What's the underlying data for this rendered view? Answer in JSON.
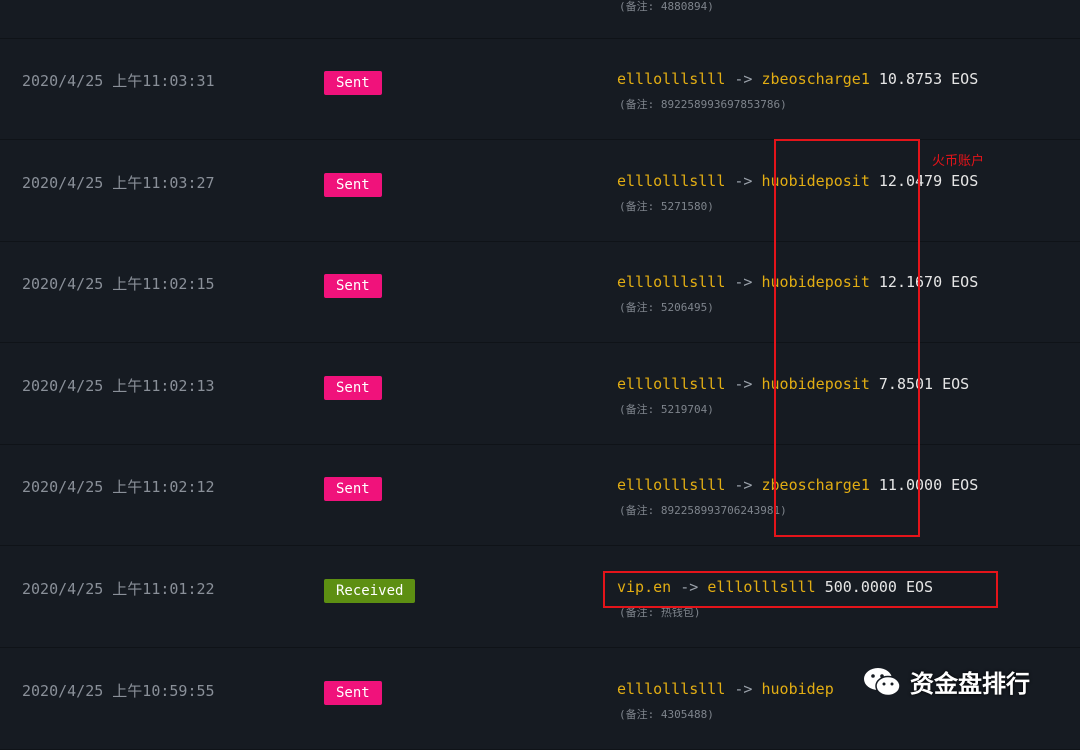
{
  "top_memo": "(备注: 4880894)",
  "rows": [
    {
      "timestamp": "2020/4/25 上午11:03:31",
      "status": "Sent",
      "from": "elllolllslll",
      "arrow": "->",
      "to": "zbeoscharge1",
      "amount": "10.8753 EOS",
      "memo": "(备注: 892258993697853786)"
    },
    {
      "timestamp": "2020/4/25 上午11:03:27",
      "status": "Sent",
      "from": "elllolllslll",
      "arrow": "->",
      "to": "huobideposit",
      "amount": "12.0479 EOS",
      "memo": "(备注: 5271580)"
    },
    {
      "timestamp": "2020/4/25 上午11:02:15",
      "status": "Sent",
      "from": "elllolllslll",
      "arrow": "->",
      "to": "huobideposit",
      "amount": "12.1670 EOS",
      "memo": "(备注: 5206495)"
    },
    {
      "timestamp": "2020/4/25 上午11:02:13",
      "status": "Sent",
      "from": "elllolllslll",
      "arrow": "->",
      "to": "huobideposit",
      "amount": "7.8501 EOS",
      "memo": "(备注: 5219704)"
    },
    {
      "timestamp": "2020/4/25 上午11:02:12",
      "status": "Sent",
      "from": "elllolllslll",
      "arrow": "->",
      "to": "zbeoscharge1",
      "amount": "11.0000 EOS",
      "memo": "(备注: 892258993706243981)"
    },
    {
      "timestamp": "2020/4/25 上午11:01:22",
      "status": "Received",
      "from": "vip.en",
      "arrow": "->",
      "to": "elllolllslll",
      "amount": "500.0000 EOS",
      "memo": "(备注: 热钱包)"
    },
    {
      "timestamp": "2020/4/25 上午10:59:55",
      "status": "Sent",
      "from": "elllolllslll",
      "arrow": "->",
      "to": "huobidep",
      "amount": "",
      "memo": "(备注: 4305488)"
    }
  ],
  "annotation": "火币账户",
  "watermark": "资金盘排行",
  "colors": {
    "sent": "#f0127b",
    "received": "#5d8f12",
    "account": "#e2ad13",
    "highlight": "#e4141a"
  },
  "icons": {
    "watermark_logo": "wechat-icon"
  }
}
